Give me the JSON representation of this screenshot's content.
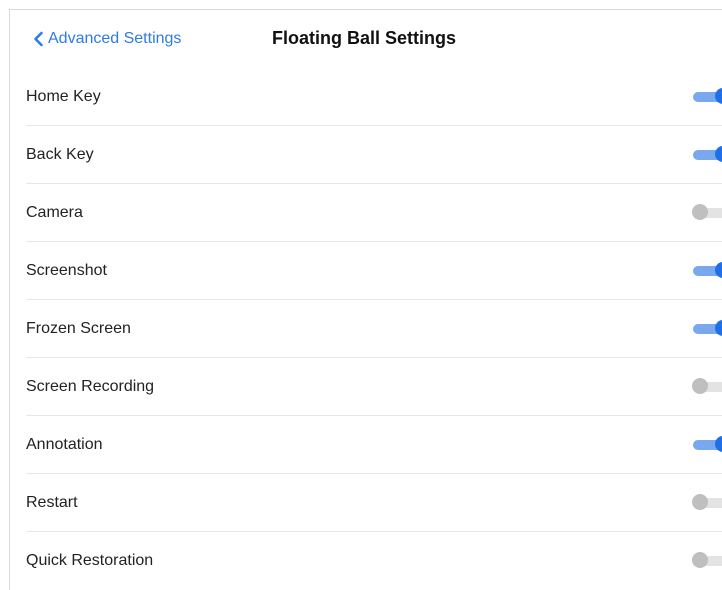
{
  "header": {
    "back_label": "Advanced Settings",
    "title": "Floating Ball Settings"
  },
  "icons": {
    "back": "chevron-left-icon"
  },
  "colors": {
    "accent": "#2f7be5",
    "toggle_on_knob": "#1f6fe8",
    "toggle_on_track": "#79a8ee",
    "toggle_off_knob": "#bfbfbf",
    "toggle_off_track": "#e3e3e3"
  },
  "settings": [
    {
      "label": "Home Key",
      "enabled": true
    },
    {
      "label": "Back Key",
      "enabled": true
    },
    {
      "label": "Camera",
      "enabled": false
    },
    {
      "label": "Screenshot",
      "enabled": true
    },
    {
      "label": "Frozen Screen",
      "enabled": true
    },
    {
      "label": "Screen Recording",
      "enabled": false
    },
    {
      "label": "Annotation",
      "enabled": true
    },
    {
      "label": "Restart",
      "enabled": false
    },
    {
      "label": "Quick Restoration",
      "enabled": false
    }
  ]
}
